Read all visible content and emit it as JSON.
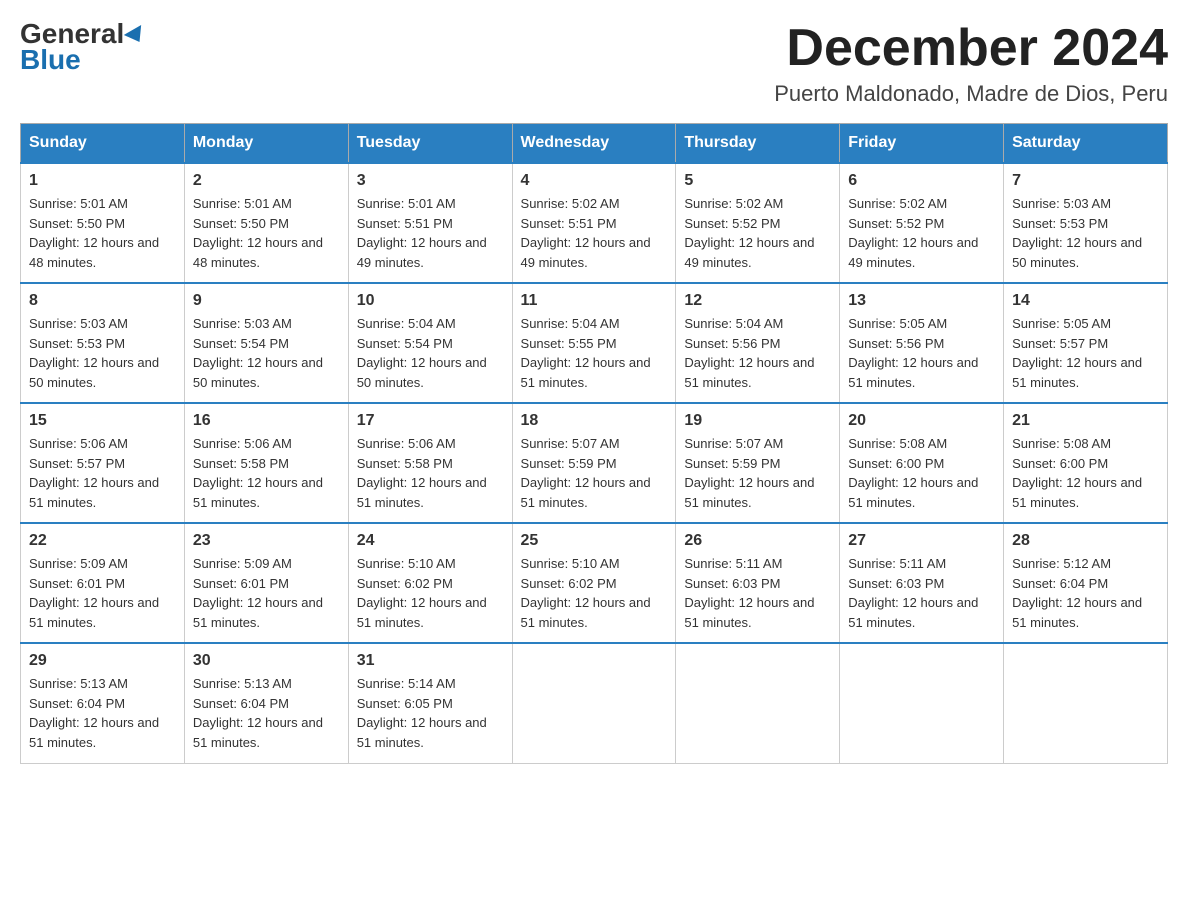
{
  "header": {
    "logo_general": "General",
    "logo_blue": "Blue",
    "month_title": "December 2024",
    "location": "Puerto Maldonado, Madre de Dios, Peru"
  },
  "weekdays": [
    "Sunday",
    "Monday",
    "Tuesday",
    "Wednesday",
    "Thursday",
    "Friday",
    "Saturday"
  ],
  "weeks": [
    [
      {
        "day": "1",
        "sunrise": "5:01 AM",
        "sunset": "5:50 PM",
        "daylight": "12 hours and 48 minutes."
      },
      {
        "day": "2",
        "sunrise": "5:01 AM",
        "sunset": "5:50 PM",
        "daylight": "12 hours and 48 minutes."
      },
      {
        "day": "3",
        "sunrise": "5:01 AM",
        "sunset": "5:51 PM",
        "daylight": "12 hours and 49 minutes."
      },
      {
        "day": "4",
        "sunrise": "5:02 AM",
        "sunset": "5:51 PM",
        "daylight": "12 hours and 49 minutes."
      },
      {
        "day": "5",
        "sunrise": "5:02 AM",
        "sunset": "5:52 PM",
        "daylight": "12 hours and 49 minutes."
      },
      {
        "day": "6",
        "sunrise": "5:02 AM",
        "sunset": "5:52 PM",
        "daylight": "12 hours and 49 minutes."
      },
      {
        "day": "7",
        "sunrise": "5:03 AM",
        "sunset": "5:53 PM",
        "daylight": "12 hours and 50 minutes."
      }
    ],
    [
      {
        "day": "8",
        "sunrise": "5:03 AM",
        "sunset": "5:53 PM",
        "daylight": "12 hours and 50 minutes."
      },
      {
        "day": "9",
        "sunrise": "5:03 AM",
        "sunset": "5:54 PM",
        "daylight": "12 hours and 50 minutes."
      },
      {
        "day": "10",
        "sunrise": "5:04 AM",
        "sunset": "5:54 PM",
        "daylight": "12 hours and 50 minutes."
      },
      {
        "day": "11",
        "sunrise": "5:04 AM",
        "sunset": "5:55 PM",
        "daylight": "12 hours and 51 minutes."
      },
      {
        "day": "12",
        "sunrise": "5:04 AM",
        "sunset": "5:56 PM",
        "daylight": "12 hours and 51 minutes."
      },
      {
        "day": "13",
        "sunrise": "5:05 AM",
        "sunset": "5:56 PM",
        "daylight": "12 hours and 51 minutes."
      },
      {
        "day": "14",
        "sunrise": "5:05 AM",
        "sunset": "5:57 PM",
        "daylight": "12 hours and 51 minutes."
      }
    ],
    [
      {
        "day": "15",
        "sunrise": "5:06 AM",
        "sunset": "5:57 PM",
        "daylight": "12 hours and 51 minutes."
      },
      {
        "day": "16",
        "sunrise": "5:06 AM",
        "sunset": "5:58 PM",
        "daylight": "12 hours and 51 minutes."
      },
      {
        "day": "17",
        "sunrise": "5:06 AM",
        "sunset": "5:58 PM",
        "daylight": "12 hours and 51 minutes."
      },
      {
        "day": "18",
        "sunrise": "5:07 AM",
        "sunset": "5:59 PM",
        "daylight": "12 hours and 51 minutes."
      },
      {
        "day": "19",
        "sunrise": "5:07 AM",
        "sunset": "5:59 PM",
        "daylight": "12 hours and 51 minutes."
      },
      {
        "day": "20",
        "sunrise": "5:08 AM",
        "sunset": "6:00 PM",
        "daylight": "12 hours and 51 minutes."
      },
      {
        "day": "21",
        "sunrise": "5:08 AM",
        "sunset": "6:00 PM",
        "daylight": "12 hours and 51 minutes."
      }
    ],
    [
      {
        "day": "22",
        "sunrise": "5:09 AM",
        "sunset": "6:01 PM",
        "daylight": "12 hours and 51 minutes."
      },
      {
        "day": "23",
        "sunrise": "5:09 AM",
        "sunset": "6:01 PM",
        "daylight": "12 hours and 51 minutes."
      },
      {
        "day": "24",
        "sunrise": "5:10 AM",
        "sunset": "6:02 PM",
        "daylight": "12 hours and 51 minutes."
      },
      {
        "day": "25",
        "sunrise": "5:10 AM",
        "sunset": "6:02 PM",
        "daylight": "12 hours and 51 minutes."
      },
      {
        "day": "26",
        "sunrise": "5:11 AM",
        "sunset": "6:03 PM",
        "daylight": "12 hours and 51 minutes."
      },
      {
        "day": "27",
        "sunrise": "5:11 AM",
        "sunset": "6:03 PM",
        "daylight": "12 hours and 51 minutes."
      },
      {
        "day": "28",
        "sunrise": "5:12 AM",
        "sunset": "6:04 PM",
        "daylight": "12 hours and 51 minutes."
      }
    ],
    [
      {
        "day": "29",
        "sunrise": "5:13 AM",
        "sunset": "6:04 PM",
        "daylight": "12 hours and 51 minutes."
      },
      {
        "day": "30",
        "sunrise": "5:13 AM",
        "sunset": "6:04 PM",
        "daylight": "12 hours and 51 minutes."
      },
      {
        "day": "31",
        "sunrise": "5:14 AM",
        "sunset": "6:05 PM",
        "daylight": "12 hours and 51 minutes."
      },
      null,
      null,
      null,
      null
    ]
  ]
}
